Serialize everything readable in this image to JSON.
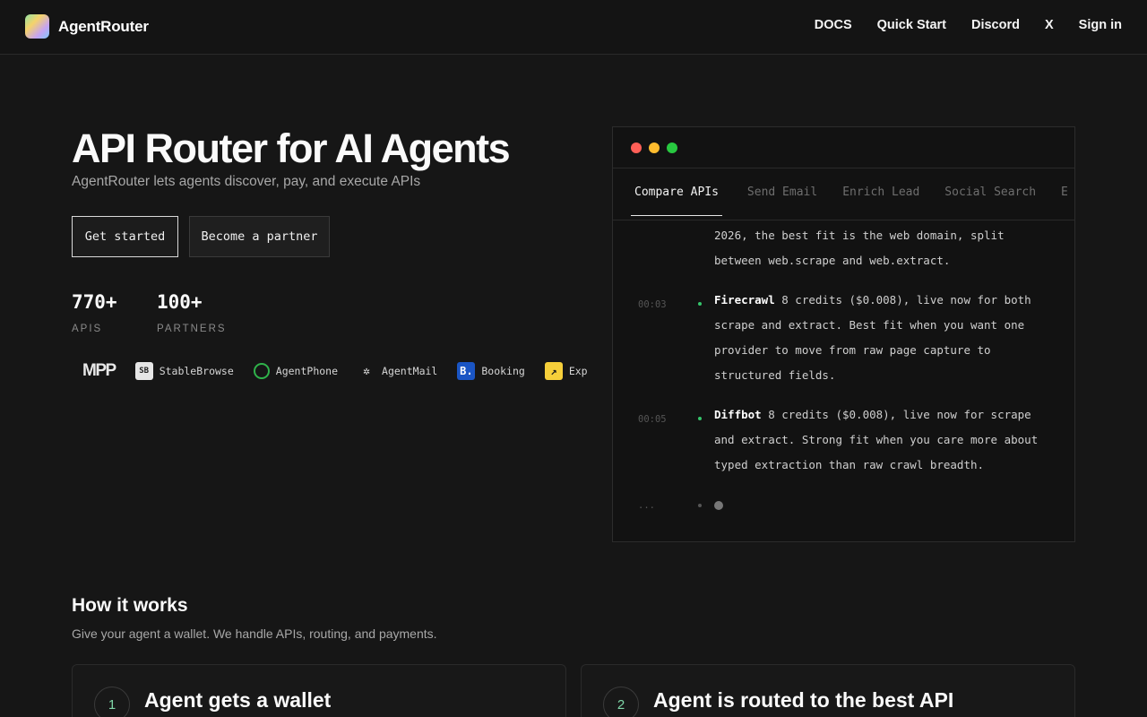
{
  "header": {
    "brand": "AgentRouter",
    "nav": [
      "DOCS",
      "Quick Start",
      "Discord",
      "X",
      "Sign in"
    ]
  },
  "hero": {
    "title": "API Router for AI Agents",
    "subtitle": "AgentRouter lets agents discover, pay, and execute APIs",
    "primary_cta": "Get started",
    "secondary_cta": "Become a partner",
    "stats": [
      {
        "value": "770+",
        "label": "APIS"
      },
      {
        "value": "100+",
        "label": "PARTNERS"
      }
    ],
    "partners": [
      {
        "name": "MPP",
        "icon": "mpp-logo"
      },
      {
        "name": "StableBrowse",
        "icon": "stablebrowse-logo",
        "mark": "SB"
      },
      {
        "name": "AgentPhone",
        "icon": "agentphone-logo",
        "mark": ""
      },
      {
        "name": "AgentMail",
        "icon": "agentmail-logo",
        "mark": "✲"
      },
      {
        "name": "Booking",
        "icon": "booking-logo",
        "mark": "B."
      },
      {
        "name": "Exp",
        "icon": "exp-logo",
        "mark": "↗"
      }
    ]
  },
  "terminal": {
    "tabs": [
      "Compare APIs",
      "Send Email",
      "Enrich Lead",
      "Social Search",
      "E"
    ],
    "active_tab": 0,
    "entries": [
      {
        "time": "",
        "name": "",
        "text": "2026, the best fit is the web domain, split between web.scrape and web.extract."
      },
      {
        "time": "00:03",
        "name": "Firecrawl",
        "text": " 8 credits ($0.008), live now for both scrape and extract. Best fit when you want one provider to move from raw page capture to structured fields."
      },
      {
        "time": "00:05",
        "name": "Diffbot",
        "text": " 8 credits ($0.008), live now for scrape and extract. Strong fit when you care more about typed extraction than raw crawl breadth."
      },
      {
        "time": "...",
        "name": "",
        "text": ""
      }
    ]
  },
  "how": {
    "title": "How it works",
    "subtitle": "Give your agent a wallet. We handle APIs, routing, and payments.",
    "steps": [
      {
        "number": "1",
        "title": "Agent gets a wallet"
      },
      {
        "number": "2",
        "title": "Agent is routed to the best API"
      }
    ]
  },
  "colors": {
    "background": "#161616",
    "accent_green": "#35c46b",
    "traffic_red": "#ff5f57",
    "traffic_yellow": "#febc2e",
    "traffic_green": "#28c840"
  }
}
